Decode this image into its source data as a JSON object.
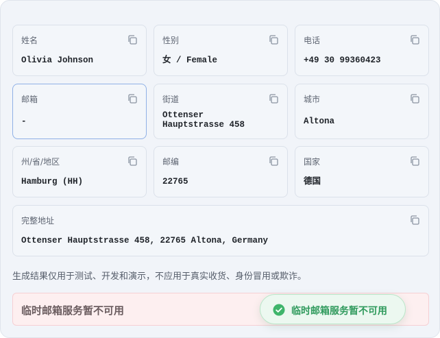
{
  "fields": [
    {
      "label": "姓名",
      "value": "Olivia Johnson"
    },
    {
      "label": "性别",
      "value": "女 / Female"
    },
    {
      "label": "电话",
      "value": "+49 30 99360423"
    },
    {
      "label": "邮箱",
      "value": "-"
    },
    {
      "label": "街道",
      "value": "Ottenser Hauptstrasse 458"
    },
    {
      "label": "城市",
      "value": "Altona"
    },
    {
      "label": "州/省/地区",
      "value": "Hamburg (HH)"
    },
    {
      "label": "邮编",
      "value": "22765"
    },
    {
      "label": "国家",
      "value": "德国"
    },
    {
      "label": "完整地址",
      "value": "Ottenser Hauptstrasse 458, 22765 Altona, Germany"
    }
  ],
  "disclaimer": "生成结果仅用于测试、开发和演示，不应用于真实收货、身份冒用或欺诈。",
  "alert": {
    "text": "临时邮箱服务暂不可用"
  },
  "toast": {
    "text": "临时邮箱服务暂不可用",
    "icon": "check-circle-icon",
    "color": "#2f9a5c"
  },
  "icons": {
    "copy": "copy-icon"
  },
  "colors": {
    "accent_border": "#8fb0e6",
    "alert_bg": "#fdeff0"
  }
}
